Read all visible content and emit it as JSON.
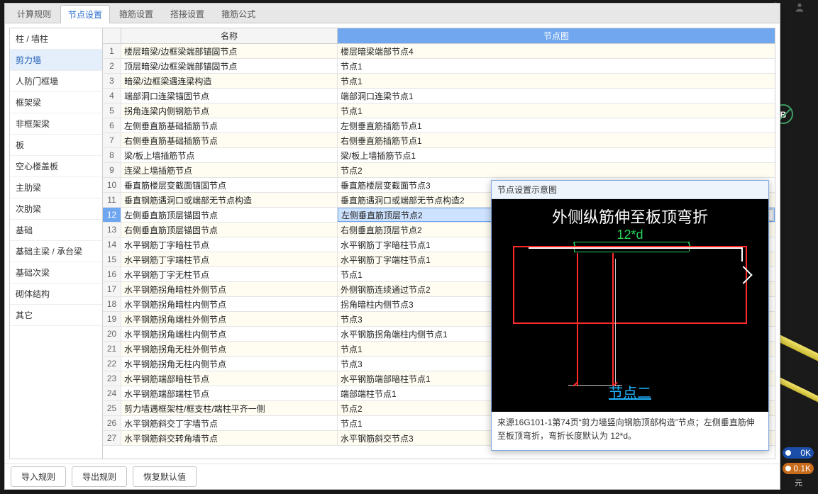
{
  "tabs": [
    "计算规则",
    "节点设置",
    "箍筋设置",
    "搭接设置",
    "箍筋公式"
  ],
  "active_tab_index": 1,
  "sidebar": {
    "items": [
      "柱 / 墙柱",
      "剪力墙",
      "人防门框墙",
      "框架梁",
      "非框架梁",
      "板",
      "空心楼盖板",
      "主肋梁",
      "次肋梁",
      "基础",
      "基础主梁 / 承台梁",
      "基础次梁",
      "砌体结构",
      "其它"
    ],
    "selected_index": 1
  },
  "table": {
    "headers": {
      "num": "",
      "name": "名称",
      "diagram": "节点图"
    },
    "selected_index": 11,
    "edit_button": "···",
    "rows": [
      {
        "name": "楼层暗梁/边框梁端部锚固节点",
        "diagram": "楼层暗梁端部节点4"
      },
      {
        "name": "顶层暗梁/边框梁端部锚固节点",
        "diagram": "节点1"
      },
      {
        "name": "暗梁/边框梁遇连梁构造",
        "diagram": "节点1"
      },
      {
        "name": "端部洞口连梁锚固节点",
        "diagram": "端部洞口连梁节点1"
      },
      {
        "name": "拐角连梁内侧钢筋节点",
        "diagram": "节点1"
      },
      {
        "name": "左侧垂直筋基础插筋节点",
        "diagram": "左侧垂直筋插筋节点1"
      },
      {
        "name": "右侧垂直筋基础插筋节点",
        "diagram": "右侧垂直筋插筋节点1"
      },
      {
        "name": "梁/板上墙插筋节点",
        "diagram": "梁/板上墙插筋节点1"
      },
      {
        "name": "连梁上墙插筋节点",
        "diagram": "节点2"
      },
      {
        "name": "垂直筋楼层变截面锚固节点",
        "diagram": "垂直筋楼层变截面节点3"
      },
      {
        "name": "垂直钢筋遇洞口或端部无节点构造",
        "diagram": "垂直筋遇洞口或端部无节点构造2"
      },
      {
        "name": "左侧垂直筋顶层锚固节点",
        "diagram": "左侧垂直筋顶层节点2"
      },
      {
        "name": "右侧垂直筋顶层锚固节点",
        "diagram": "右侧垂直筋顶层节点2"
      },
      {
        "name": "水平钢筋丁字暗柱节点",
        "diagram": "水平钢筋丁字暗柱节点1"
      },
      {
        "name": "水平钢筋丁字端柱节点",
        "diagram": "水平钢筋丁字端柱节点1"
      },
      {
        "name": "水平钢筋丁字无柱节点",
        "diagram": "节点1"
      },
      {
        "name": "水平钢筋拐角暗柱外侧节点",
        "diagram": "外侧钢筋连续通过节点2"
      },
      {
        "name": "水平钢筋拐角暗柱内侧节点",
        "diagram": "拐角暗柱内侧节点3"
      },
      {
        "name": "水平钢筋拐角端柱外侧节点",
        "diagram": "节点3"
      },
      {
        "name": "水平钢筋拐角端柱内侧节点",
        "diagram": "水平钢筋拐角端柱内侧节点1"
      },
      {
        "name": "水平钢筋拐角无柱外侧节点",
        "diagram": "节点1"
      },
      {
        "name": "水平钢筋拐角无柱内侧节点",
        "diagram": "节点3"
      },
      {
        "name": "水平钢筋端部暗柱节点",
        "diagram": "水平钢筋端部暗柱节点1"
      },
      {
        "name": "水平钢筋端部端柱节点",
        "diagram": "端部端柱节点1"
      },
      {
        "name": "剪力墙遇框架柱/框支柱/端柱平齐一侧",
        "diagram": "节点2"
      },
      {
        "name": "水平钢筋斜交丁字墙节点",
        "diagram": "节点1"
      },
      {
        "name": "水平钢筋斜交转角墙节点",
        "diagram": "水平钢筋斜交节点3"
      }
    ]
  },
  "footer": {
    "import": "导入规则",
    "export": "导出规则",
    "reset": "恢复默认值"
  },
  "preview": {
    "title": "节点设置示意图",
    "top_text": "外侧纵筋伸至板顶弯折",
    "dim_text": "12*d",
    "bottom_label": "节点二",
    "desc": "来源16G101-1第74页“剪力墙竖向钢筋顶部构造”节点；左侧垂直筋伸至板顶弯折，弯折长度默认为 12*d。"
  },
  "bg": {
    "badge_letter": "B",
    "dist1": "0K",
    "dist2": "0.1K",
    "unit": "元"
  }
}
